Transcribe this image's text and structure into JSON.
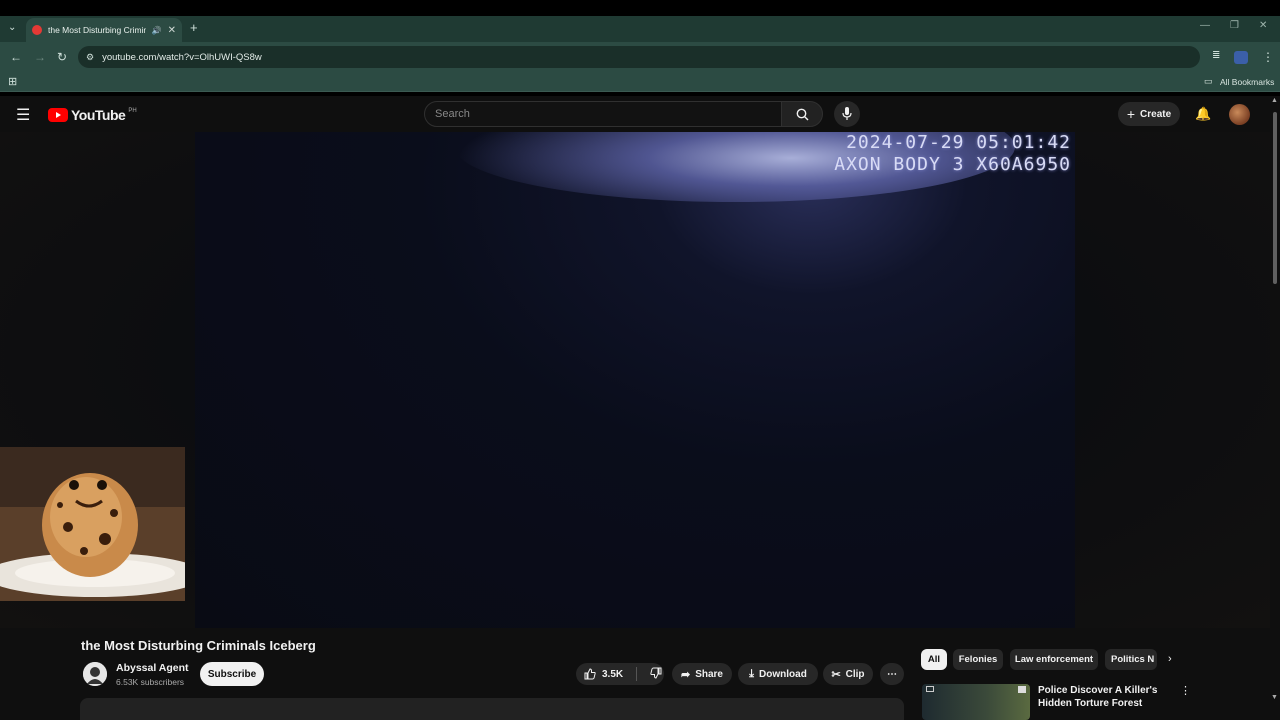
{
  "browser": {
    "tab_title": "the Most Disturbing Criminals Iceberg",
    "url": "youtube.com/watch?v=OlhUWI-QS8w",
    "all_bookmarks_label": "All Bookmarks"
  },
  "youtube": {
    "logo_text": "YouTube",
    "region": "PH",
    "search_placeholder": "Search",
    "create_label": "Create"
  },
  "video": {
    "overlay_line1": "2024-07-29 05:01:42",
    "overlay_line2": "AXON BODY 3 X60A6950",
    "title": "the Most Disturbing Criminals Iceberg"
  },
  "channel": {
    "name": "Abyssal Agent",
    "subscribers": "6.53K subscribers",
    "subscribe_label": "Subscribe"
  },
  "actions": {
    "likes": "3.5K",
    "share_label": "Share",
    "download_label": "Download",
    "clip_label": "Clip"
  },
  "chips": [
    "All",
    "Felonies",
    "Law enforcement",
    "Politics N"
  ],
  "recommendation": {
    "title": "Police Discover A Killer's Hidden Torture Forest"
  },
  "colors": {
    "chrome_dark": "#1f3a33",
    "chrome_mid": "#2c4b43",
    "yt_bg": "#0f0f0f",
    "yt_red": "#ff0000"
  }
}
